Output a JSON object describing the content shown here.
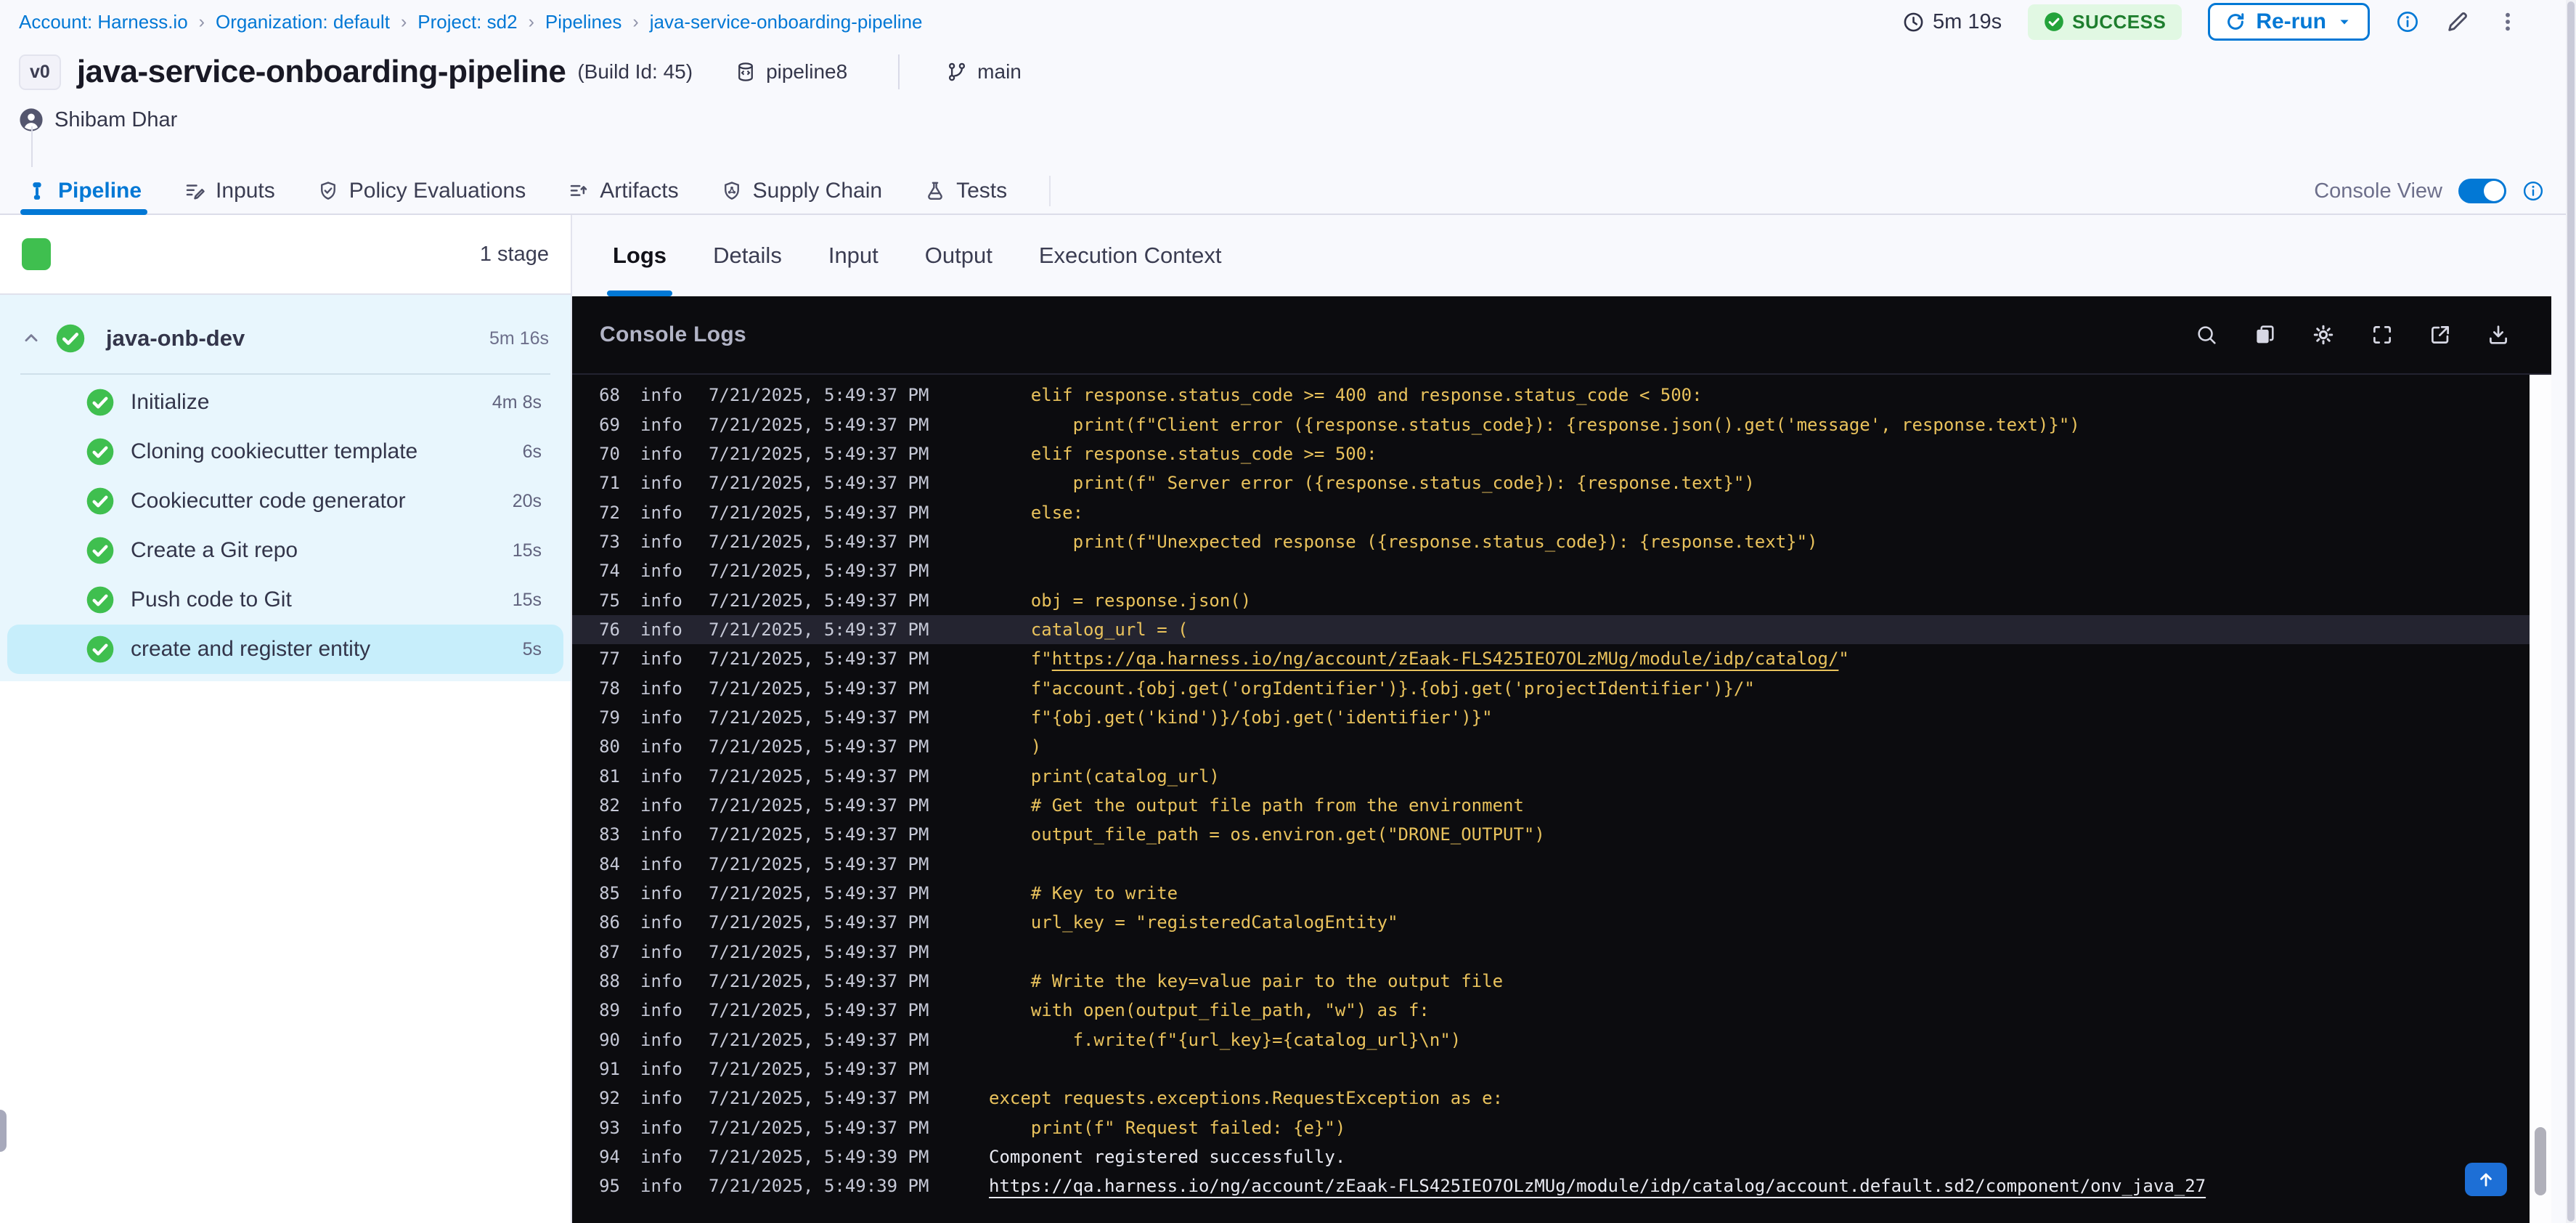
{
  "colors": {
    "accent": "#0278d5",
    "success_green": "#3fbf4f",
    "success_badge_bg": "#e1f8e3",
    "log_yellow": "#e9c25c",
    "console_bg": "#0c0c0f",
    "selected_step_bg": "#c7eefb"
  },
  "breadcrumb": {
    "separator": "›",
    "items": [
      "Account: Harness.io",
      "Organization: default",
      "Project: sd2",
      "Pipelines",
      "java-service-onboarding-pipeline"
    ]
  },
  "topbar": {
    "duration": "5m 19s",
    "status": "SUCCESS",
    "rerun_label": "Re-run"
  },
  "title": {
    "version_badge": "v0",
    "name": "java-service-onboarding-pipeline",
    "build_id": "(Build Id: 45)",
    "repo": "pipeline8",
    "branch": "main",
    "user": "Shibam Dhar"
  },
  "tabs": [
    {
      "label": "Pipeline",
      "active": true
    },
    {
      "label": "Inputs",
      "active": false
    },
    {
      "label": "Policy Evaluations",
      "active": false
    },
    {
      "label": "Artifacts",
      "active": false
    },
    {
      "label": "Supply Chain",
      "active": false
    },
    {
      "label": "Tests",
      "active": false
    }
  ],
  "console_view": {
    "label": "Console View",
    "enabled": true
  },
  "sidebar": {
    "stage_count": "1 stage",
    "stage": {
      "name": "java-onb-dev",
      "duration": "5m 16s"
    },
    "steps": [
      {
        "name": "Initialize",
        "duration": "4m 8s",
        "selected": false
      },
      {
        "name": "Cloning cookiecutter template",
        "duration": "6s",
        "selected": false
      },
      {
        "name": "Cookiecutter code generator",
        "duration": "20s",
        "selected": false
      },
      {
        "name": "Create a Git repo",
        "duration": "15s",
        "selected": false
      },
      {
        "name": "Push code to Git",
        "duration": "15s",
        "selected": false
      },
      {
        "name": "create and register entity",
        "duration": "5s",
        "selected": true
      }
    ]
  },
  "log_panel": {
    "tabs": [
      "Logs",
      "Details",
      "Input",
      "Output",
      "Execution Context"
    ],
    "active_tab": "Logs",
    "header": "Console Logs"
  },
  "logs": {
    "level": "info",
    "entries": [
      {
        "n": 68,
        "t": "7/21/2025, 5:49:37 PM",
        "k": "y",
        "text": "    elif response.status_code >= 400 and response.status_code < 500:"
      },
      {
        "n": 69,
        "t": "7/21/2025, 5:49:37 PM",
        "k": "y",
        "text": "        print(f\"Client error ({response.status_code}): {response.json().get('message', response.text)}\")"
      },
      {
        "n": 70,
        "t": "7/21/2025, 5:49:37 PM",
        "k": "y",
        "text": "    elif response.status_code >= 500:"
      },
      {
        "n": 71,
        "t": "7/21/2025, 5:49:37 PM",
        "k": "y",
        "text": "        print(f\" Server error ({response.status_code}): {response.text}\")"
      },
      {
        "n": 72,
        "t": "7/21/2025, 5:49:37 PM",
        "k": "y",
        "text": "    else:"
      },
      {
        "n": 73,
        "t": "7/21/2025, 5:49:37 PM",
        "k": "y",
        "text": "        print(f\"Unexpected response ({response.status_code}): {response.text}\")"
      },
      {
        "n": 74,
        "t": "7/21/2025, 5:49:37 PM",
        "k": "y",
        "text": ""
      },
      {
        "n": 75,
        "t": "7/21/2025, 5:49:37 PM",
        "k": "y",
        "text": "    obj = response.json()"
      },
      {
        "n": 76,
        "t": "7/21/2025, 5:49:37 PM",
        "k": "y",
        "hl": true,
        "text": "    catalog_url = ("
      },
      {
        "n": 77,
        "t": "7/21/2025, 5:49:37 PM",
        "k": "y",
        "pre": "    f\"",
        "link": "https://qa.harness.io/ng/account/zEaak-FLS425IEO7OLzMUg/module/idp/catalog/",
        "post": "\""
      },
      {
        "n": 78,
        "t": "7/21/2025, 5:49:37 PM",
        "k": "y",
        "text": "    f\"account.{obj.get('orgIdentifier')}.{obj.get('projectIdentifier')}/\""
      },
      {
        "n": 79,
        "t": "7/21/2025, 5:49:37 PM",
        "k": "y",
        "text": "    f\"{obj.get('kind')}/{obj.get('identifier')}\""
      },
      {
        "n": 80,
        "t": "7/21/2025, 5:49:37 PM",
        "k": "y",
        "text": "    )"
      },
      {
        "n": 81,
        "t": "7/21/2025, 5:49:37 PM",
        "k": "y",
        "text": "    print(catalog_url)"
      },
      {
        "n": 82,
        "t": "7/21/2025, 5:49:37 PM",
        "k": "y",
        "text": "    # Get the output file path from the environment"
      },
      {
        "n": 83,
        "t": "7/21/2025, 5:49:37 PM",
        "k": "y",
        "text": "    output_file_path = os.environ.get(\"DRONE_OUTPUT\")"
      },
      {
        "n": 84,
        "t": "7/21/2025, 5:49:37 PM",
        "k": "y",
        "text": ""
      },
      {
        "n": 85,
        "t": "7/21/2025, 5:49:37 PM",
        "k": "y",
        "text": "    # Key to write"
      },
      {
        "n": 86,
        "t": "7/21/2025, 5:49:37 PM",
        "k": "y",
        "text": "    url_key = \"registeredCatalogEntity\""
      },
      {
        "n": 87,
        "t": "7/21/2025, 5:49:37 PM",
        "k": "y",
        "text": ""
      },
      {
        "n": 88,
        "t": "7/21/2025, 5:49:37 PM",
        "k": "y",
        "text": "    # Write the key=value pair to the output file"
      },
      {
        "n": 89,
        "t": "7/21/2025, 5:49:37 PM",
        "k": "y",
        "text": "    with open(output_file_path, \"w\") as f:"
      },
      {
        "n": 90,
        "t": "7/21/2025, 5:49:37 PM",
        "k": "y",
        "text": "        f.write(f\"{url_key}={catalog_url}\\n\")"
      },
      {
        "n": 91,
        "t": "7/21/2025, 5:49:37 PM",
        "k": "y",
        "text": ""
      },
      {
        "n": 92,
        "t": "7/21/2025, 5:49:37 PM",
        "k": "y",
        "text": "except requests.exceptions.RequestException as e:"
      },
      {
        "n": 93,
        "t": "7/21/2025, 5:49:37 PM",
        "k": "y",
        "text": "    print(f\" Request failed: {e}\")"
      },
      {
        "n": 94,
        "t": "7/21/2025, 5:49:39 PM",
        "k": "w",
        "text": "Component registered successfully."
      },
      {
        "n": 95,
        "t": "7/21/2025, 5:49:39 PM",
        "k": "w",
        "pre": "",
        "link": "https://qa.harness.io/ng/account/zEaak-FLS425IEO7OLzMUg/module/idp/catalog/account.default.sd2/component/onv_java_27",
        "post": ""
      }
    ]
  }
}
